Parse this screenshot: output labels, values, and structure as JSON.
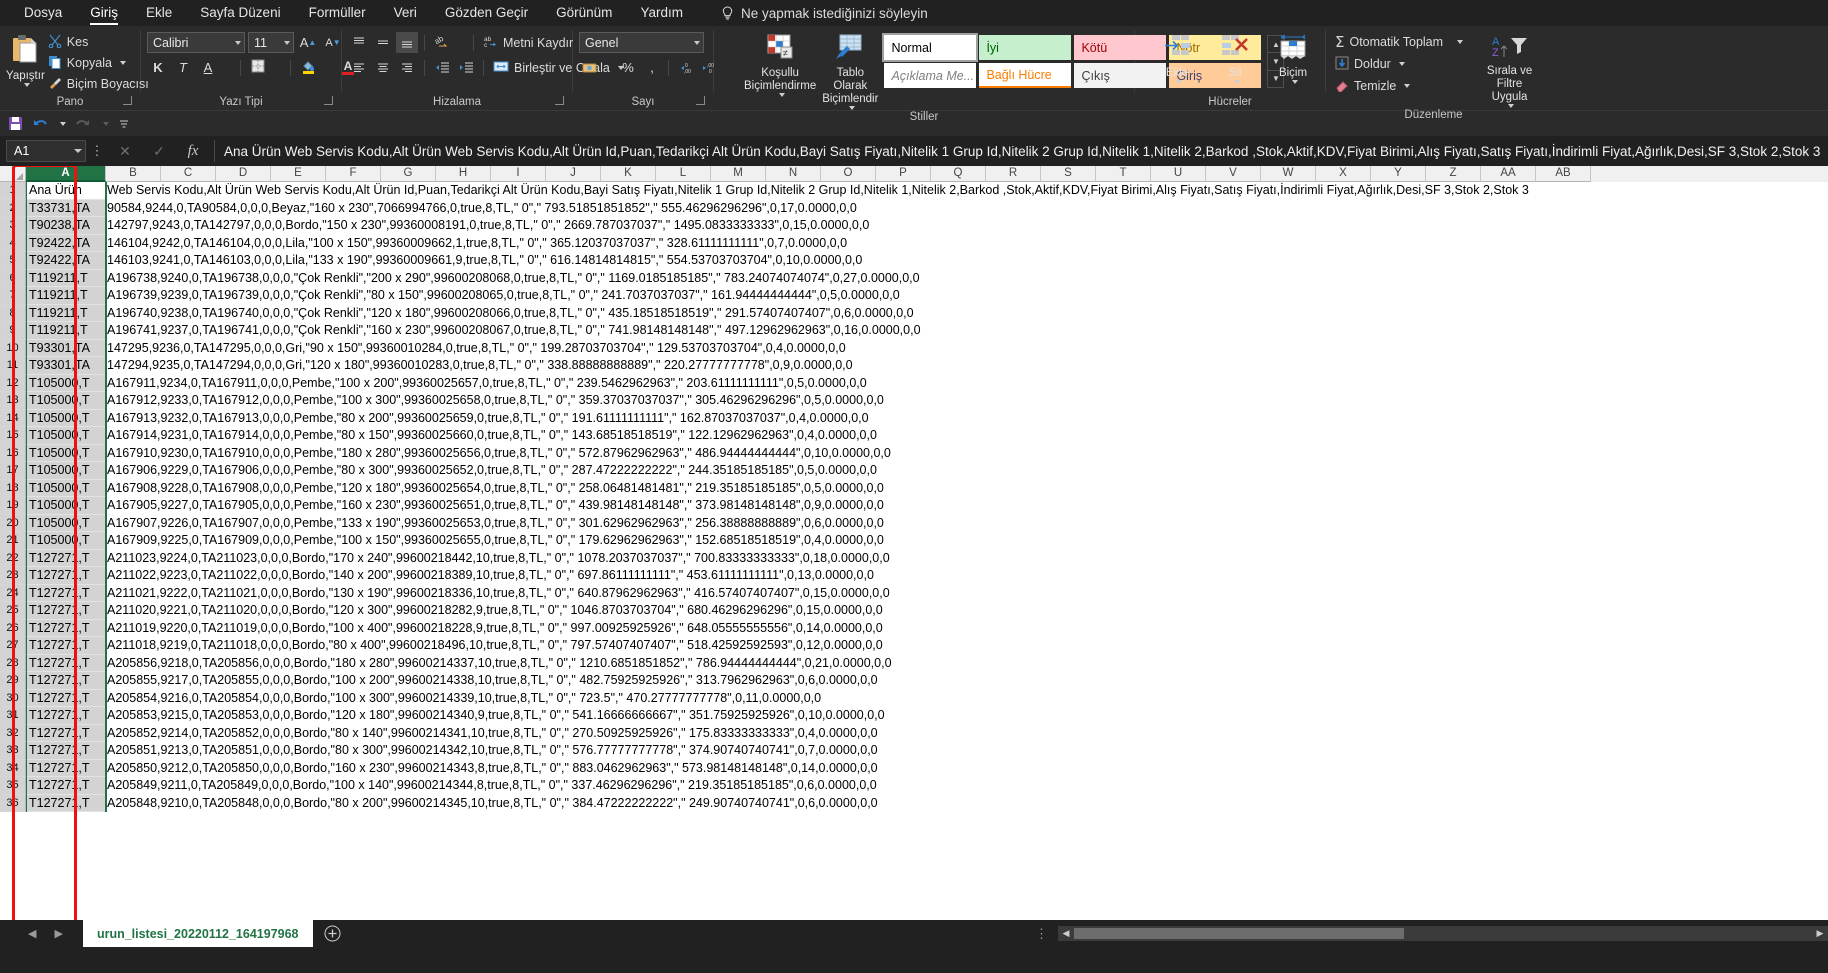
{
  "ribbon": {
    "tabs": [
      {
        "label": "Dosya",
        "active": false
      },
      {
        "label": "Giriş",
        "active": true
      },
      {
        "label": "Ekle",
        "active": false
      },
      {
        "label": "Sayfa Düzeni",
        "active": false
      },
      {
        "label": "Formüller",
        "active": false
      },
      {
        "label": "Veri",
        "active": false
      },
      {
        "label": "Gözden Geçir",
        "active": false
      },
      {
        "label": "Görünüm",
        "active": false
      },
      {
        "label": "Yardım",
        "active": false
      }
    ],
    "tell_me": "Ne yapmak istediğinizi söyleyin",
    "groups": {
      "clipboard": {
        "label": "Pano",
        "paste": "Yapıştır",
        "cut": "Kes",
        "copy": "Kopyala",
        "format_painter": "Biçim Boyacısı"
      },
      "font": {
        "label": "Yazı Tipi",
        "font_name": "Calibri",
        "font_size": "11",
        "bold": "K",
        "italic": "T",
        "underline": "A",
        "grow": "A",
        "shrink": "A"
      },
      "alignment": {
        "label": "Hizalama",
        "wrap_text": "Metni Kaydır",
        "merge_center": "Birleştir ve Ortala"
      },
      "number": {
        "label": "Sayı",
        "format": "Genel",
        "percent": "%",
        "comma": ","
      },
      "styles": {
        "label": "Stiller",
        "conditional": "Koşullu Biçimlendirme",
        "table_format": "Tablo Olarak Biçimlendir",
        "cells": [
          {
            "label": "Normal",
            "bg": "#ffffff",
            "fg": "#000000",
            "selected": true
          },
          {
            "label": "İyi",
            "bg": "#c6efce",
            "fg": "#006100",
            "selected": false
          },
          {
            "label": "Kötü",
            "bg": "#ffc7ce",
            "fg": "#9c0006",
            "selected": false
          },
          {
            "label": "Nötr",
            "bg": "#ffeb9c",
            "fg": "#9c6500",
            "selected": false
          },
          {
            "label": "Açıklama Me...",
            "bg": "#ffffff",
            "fg": "#7f7f7f",
            "selected": false
          },
          {
            "label": "Bağlı Hücre",
            "bg": "#ffffff",
            "fg": "#fa7d00",
            "selected": false
          },
          {
            "label": "Çıkış",
            "bg": "#f2f2f2",
            "fg": "#3f3f3f",
            "selected": false
          },
          {
            "label": "Giriş",
            "bg": "#ffcc99",
            "fg": "#3f3f76",
            "selected": false
          }
        ]
      },
      "cells_group": {
        "label": "Hücreler",
        "insert": "Ekle",
        "delete": "Sil",
        "format": "Biçim"
      },
      "editing": {
        "label": "Düzenleme",
        "autosum": "Otomatik Toplam",
        "fill": "Doldur",
        "clear": "Temizle",
        "sort_filter": "Sırala ve Filtre Uygula"
      }
    }
  },
  "formula_bar": {
    "name_box": "A1",
    "cancel": "✕",
    "enter": "✓",
    "fx": "fx",
    "value": "Ana Ürün Web Servis Kodu,Alt Ürün Web Servis Kodu,Alt Ürün Id,Puan,Tedarikçi Alt Ürün Kodu,Bayi Satış Fiyatı,Nitelik 1 Grup Id,Nitelik 2 Grup Id,Nitelik 1,Nitelik 2,Barkod ,Stok,Aktif,KDV,Fiyat Birimi,Alış Fiyatı,Satış Fiyatı,İndirimli Fiyat,Ağırlık,Desi,SF 3,Stok 2,Stok 3"
  },
  "grid": {
    "columns": [
      "A",
      "B",
      "C",
      "D",
      "E",
      "F",
      "G",
      "H",
      "I",
      "J",
      "K",
      "L",
      "M",
      "N",
      "O",
      "P",
      "Q",
      "R",
      "S",
      "T",
      "U",
      "V",
      "W",
      "X",
      "Y",
      "Z",
      "AA",
      "AB"
    ],
    "selected_column": "A",
    "rows": [
      {
        "n": "1",
        "a": "Ana Ürün",
        "text": "Web Servis Kodu,Alt Ürün Web Servis Kodu,Alt Ürün Id,Puan,Tedarikçi Alt Ürün Kodu,Bayi Satış Fiyatı,Nitelik 1 Grup Id,Nitelik 2 Grup Id,Nitelik 1,Nitelik 2,Barkod ,Stok,Aktif,KDV,Fiyat Birimi,Alış Fiyatı,Satış Fiyatı,İndirimli Fiyat,Ağırlık,Desi,SF 3,Stok 2,Stok 3"
      },
      {
        "n": "2",
        "a": "T33731,TA",
        "text": "90584,9244,0,TA90584,0,0,0,Beyaz,\"160 x 230\",7066994766,0,true,8,TL,\" 0\",\" 793.51851851852\",\" 555.46296296296\",0,17,0.0000,0,0"
      },
      {
        "n": "3",
        "a": "T90238,TA",
        "text": "142797,9243,0,TA142797,0,0,0,Bordo,\"150 x 230\",99360008191,0,true,8,TL,\" 0\",\" 2669.787037037\",\" 1495.0833333333\",0,15,0.0000,0,0"
      },
      {
        "n": "4",
        "a": "T92422,TA",
        "text": "146104,9242,0,TA146104,0,0,0,Lila,\"100 x 150\",99360009662,1,true,8,TL,\" 0\",\" 365.12037037037\",\" 328.61111111111\",0,7,0.0000,0,0"
      },
      {
        "n": "5",
        "a": "T92422,TA",
        "text": "146103,9241,0,TA146103,0,0,0,Lila,\"133 x 190\",99360009661,9,true,8,TL,\" 0\",\" 616.14814814815\",\" 554.53703703704\",0,10,0.0000,0,0"
      },
      {
        "n": "6",
        "a": "T119211,T",
        "text": "A196738,9240,0,TA196738,0,0,0,\"Çok Renkli\",\"200 x 290\",99600208068,0,true,8,TL,\" 0\",\" 1169.0185185185\",\" 783.24074074074\",0,27,0.0000,0,0"
      },
      {
        "n": "7",
        "a": "T119211,T",
        "text": "A196739,9239,0,TA196739,0,0,0,\"Çok Renkli\",\"80 x 150\",99600208065,0,true,8,TL,\" 0\",\" 241.7037037037\",\" 161.94444444444\",0,5,0.0000,0,0"
      },
      {
        "n": "8",
        "a": "T119211,T",
        "text": "A196740,9238,0,TA196740,0,0,0,\"Çok Renkli\",\"120 x 180\",99600208066,0,true,8,TL,\" 0\",\" 435.18518518519\",\" 291.57407407407\",0,6,0.0000,0,0"
      },
      {
        "n": "9",
        "a": "T119211,T",
        "text": "A196741,9237,0,TA196741,0,0,0,\"Çok Renkli\",\"160 x 230\",99600208067,0,true,8,TL,\" 0\",\" 741.98148148148\",\" 497.12962962963\",0,16,0.0000,0,0"
      },
      {
        "n": "10",
        "a": "T93301,TA",
        "text": "147295,9236,0,TA147295,0,0,0,Gri,\"90 x 150\",99360010284,0,true,8,TL,\" 0\",\" 199.28703703704\",\" 129.53703703704\",0,4,0.0000,0,0"
      },
      {
        "n": "11",
        "a": "T93301,TA",
        "text": "147294,9235,0,TA147294,0,0,0,Gri,\"120 x 180\",99360010283,0,true,8,TL,\" 0\",\" 338.88888888889\",\" 220.27777777778\",0,9,0.0000,0,0"
      },
      {
        "n": "12",
        "a": "T105000,T",
        "text": "A167911,9234,0,TA167911,0,0,0,Pembe,\"100 x 200\",99360025657,0,true,8,TL,\" 0\",\" 239.5462962963\",\" 203.61111111111\",0,5,0.0000,0,0"
      },
      {
        "n": "13",
        "a": "T105000,T",
        "text": "A167912,9233,0,TA167912,0,0,0,Pembe,\"100 x 300\",99360025658,0,true,8,TL,\" 0\",\" 359.37037037037\",\" 305.46296296296\",0,5,0.0000,0,0"
      },
      {
        "n": "14",
        "a": "T105000,T",
        "text": "A167913,9232,0,TA167913,0,0,0,Pembe,\"80 x 200\",99360025659,0,true,8,TL,\" 0\",\" 191.61111111111\",\" 162.87037037037\",0,4,0.0000,0,0"
      },
      {
        "n": "15",
        "a": "T105000,T",
        "text": "A167914,9231,0,TA167914,0,0,0,Pembe,\"80 x 150\",99360025660,0,true,8,TL,\" 0\",\" 143.68518518519\",\" 122.12962962963\",0,4,0.0000,0,0"
      },
      {
        "n": "16",
        "a": "T105000,T",
        "text": "A167910,9230,0,TA167910,0,0,0,Pembe,\"180 x 280\",99360025656,0,true,8,TL,\" 0\",\" 572.87962962963\",\" 486.94444444444\",0,10,0.0000,0,0"
      },
      {
        "n": "17",
        "a": "T105000,T",
        "text": "A167906,9229,0,TA167906,0,0,0,Pembe,\"80 x 300\",99360025652,0,true,8,TL,\" 0\",\" 287.47222222222\",\" 244.35185185185\",0,5,0.0000,0,0"
      },
      {
        "n": "18",
        "a": "T105000,T",
        "text": "A167908,9228,0,TA167908,0,0,0,Pembe,\"120 x 180\",99360025654,0,true,8,TL,\" 0\",\" 258.06481481481\",\" 219.35185185185\",0,5,0.0000,0,0"
      },
      {
        "n": "19",
        "a": "T105000,T",
        "text": "A167905,9227,0,TA167905,0,0,0,Pembe,\"160 x 230\",99360025651,0,true,8,TL,\" 0\",\" 439.98148148148\",\" 373.98148148148\",0,9,0.0000,0,0"
      },
      {
        "n": "20",
        "a": "T105000,T",
        "text": "A167907,9226,0,TA167907,0,0,0,Pembe,\"133 x 190\",99360025653,0,true,8,TL,\" 0\",\" 301.62962962963\",\" 256.38888888889\",0,6,0.0000,0,0"
      },
      {
        "n": "21",
        "a": "T105000,T",
        "text": "A167909,9225,0,TA167909,0,0,0,Pembe,\"100 x 150\",99360025655,0,true,8,TL,\" 0\",\" 179.62962962963\",\" 152.68518518519\",0,4,0.0000,0,0"
      },
      {
        "n": "22",
        "a": "T127271,T",
        "text": "A211023,9224,0,TA211023,0,0,0,Bordo,\"170 x 240\",99600218442,10,true,8,TL,\" 0\",\" 1078.2037037037\",\" 700.83333333333\",0,18,0.0000,0,0"
      },
      {
        "n": "23",
        "a": "T127271,T",
        "text": "A211022,9223,0,TA211022,0,0,0,Bordo,\"140 x 200\",99600218389,10,true,8,TL,\" 0\",\" 697.86111111111\",\" 453.61111111111\",0,13,0.0000,0,0"
      },
      {
        "n": "24",
        "a": "T127271,T",
        "text": "A211021,9222,0,TA211021,0,0,0,Bordo,\"130 x 190\",99600218336,10,true,8,TL,\" 0\",\" 640.87962962963\",\" 416.57407407407\",0,15,0.0000,0,0"
      },
      {
        "n": "25",
        "a": "T127271,T",
        "text": "A211020,9221,0,TA211020,0,0,0,Bordo,\"120 x 300\",99600218282,9,true,8,TL,\" 0\",\" 1046.8703703704\",\" 680.46296296296\",0,15,0.0000,0,0"
      },
      {
        "n": "26",
        "a": "T127271,T",
        "text": "A211019,9220,0,TA211019,0,0,0,Bordo,\"100 x 400\",99600218228,9,true,8,TL,\" 0\",\" 997.00925925926\",\" 648.05555555556\",0,14,0.0000,0,0"
      },
      {
        "n": "27",
        "a": "T127271,T",
        "text": "A211018,9219,0,TA211018,0,0,0,Bordo,\"80 x 400\",99600218496,10,true,8,TL,\" 0\",\" 797.57407407407\",\" 518.42592592593\",0,12,0.0000,0,0"
      },
      {
        "n": "28",
        "a": "T127271,T",
        "text": "A205856,9218,0,TA205856,0,0,0,Bordo,\"180 x 280\",99600214337,10,true,8,TL,\" 0\",\" 1210.6851851852\",\" 786.94444444444\",0,21,0.0000,0,0"
      },
      {
        "n": "29",
        "a": "T127271,T",
        "text": "A205855,9217,0,TA205855,0,0,0,Bordo,\"100 x 200\",99600214338,10,true,8,TL,\" 0\",\" 482.75925925926\",\" 313.7962962963\",0,6,0.0000,0,0"
      },
      {
        "n": "30",
        "a": "T127271,T",
        "text": "A205854,9216,0,TA205854,0,0,0,Bordo,\"100 x 300\",99600214339,10,true,8,TL,\" 0\",\" 723.5\",\" 470.27777777778\",0,11,0.0000,0,0"
      },
      {
        "n": "31",
        "a": "T127271,T",
        "text": "A205853,9215,0,TA205853,0,0,0,Bordo,\"120 x 180\",99600214340,9,true,8,TL,\" 0\",\" 541.16666666667\",\" 351.75925925926\",0,10,0.0000,0,0"
      },
      {
        "n": "32",
        "a": "T127271,T",
        "text": "A205852,9214,0,TA205852,0,0,0,Bordo,\"80 x 140\",99600214341,10,true,8,TL,\" 0\",\" 270.50925925926\",\" 175.83333333333\",0,4,0.0000,0,0"
      },
      {
        "n": "33",
        "a": "T127271,T",
        "text": "A205851,9213,0,TA205851,0,0,0,Bordo,\"80 x 300\",99600214342,10,true,8,TL,\" 0\",\" 576.77777777778\",\" 374.90740740741\",0,7,0.0000,0,0"
      },
      {
        "n": "34",
        "a": "T127271,T",
        "text": "A205850,9212,0,TA205850,0,0,0,Bordo,\"160 x 230\",99600214343,8,true,8,TL,\" 0\",\" 883.0462962963\",\" 573.98148148148\",0,14,0.0000,0,0"
      },
      {
        "n": "35",
        "a": "T127271,T",
        "text": "A205849,9211,0,TA205849,0,0,0,Bordo,\"100 x 140\",99600214344,8,true,8,TL,\" 0\",\" 337.46296296296\",\" 219.35185185185\",0,6,0.0000,0,0"
      },
      {
        "n": "36",
        "a": "T127271,T",
        "text": "A205848,9210,0,TA205848,0,0,0,Bordo,\"80 x 200\",99600214345,10,true,8,TL,\" 0\",\" 384.47222222222\",\" 249.90740740741\",0,6,0.0000,0,0"
      }
    ]
  },
  "sheet_tabs": {
    "active": "urun_listesi_20220112_164197968",
    "add_label": "+",
    "prev": "◀",
    "next": "▶"
  }
}
